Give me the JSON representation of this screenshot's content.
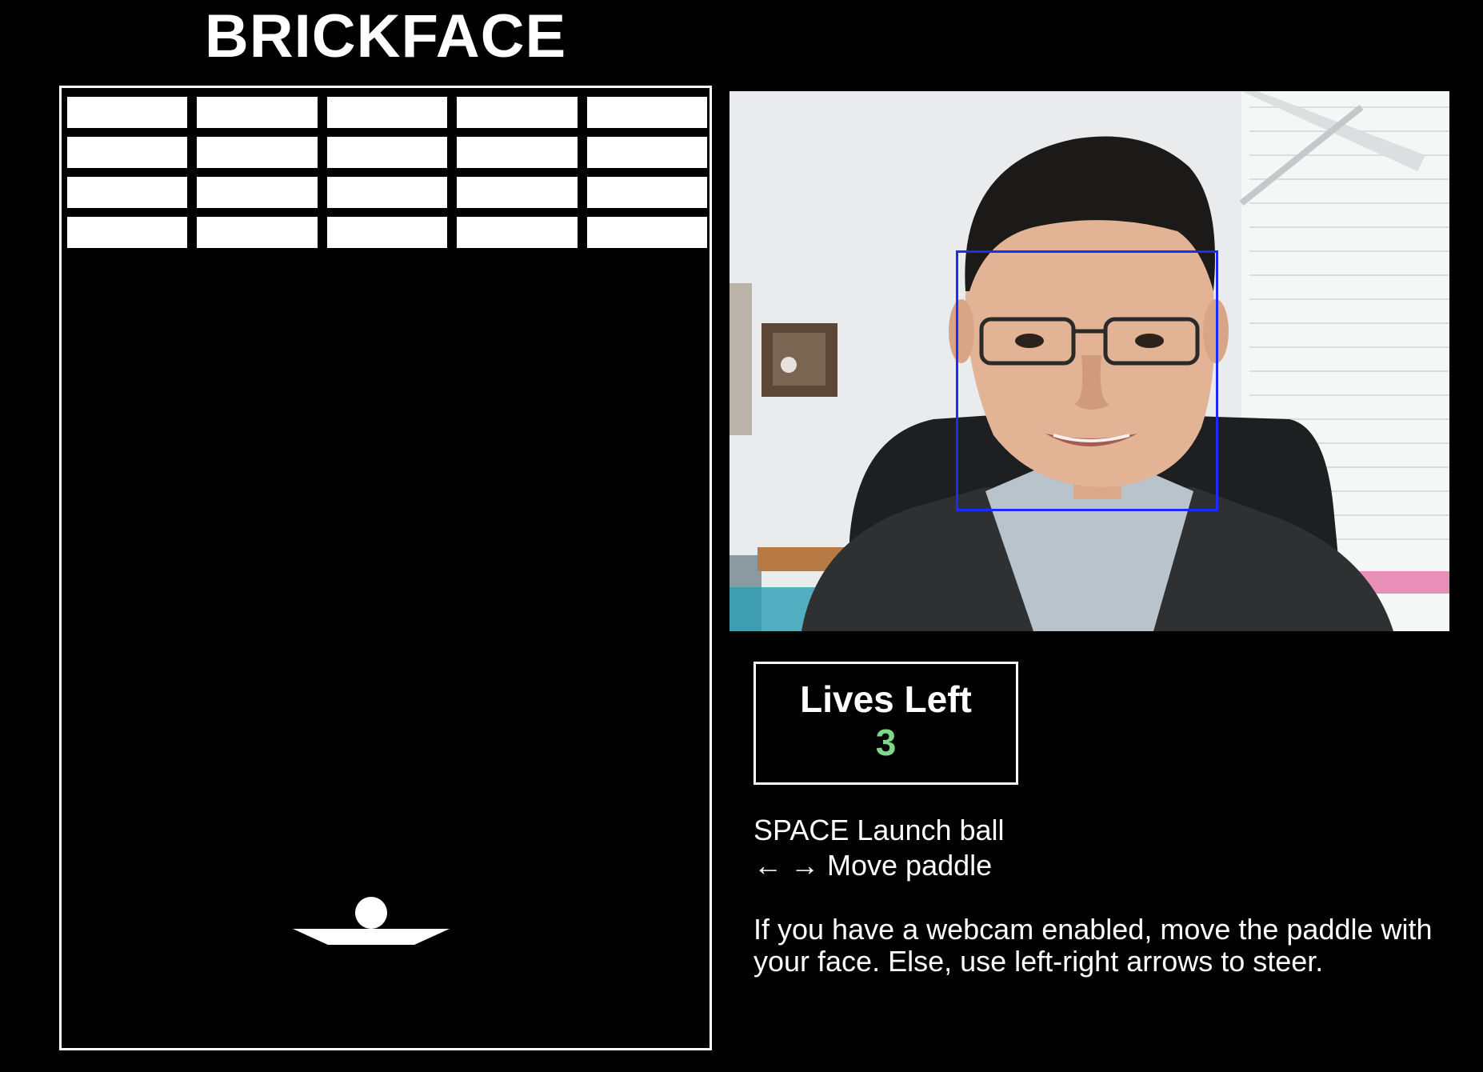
{
  "title": "BRICKFACE",
  "bricks": {
    "rows": 4,
    "columns": 5
  },
  "lives": {
    "label": "Lives Left",
    "value": "3",
    "color": "#7fd88a"
  },
  "controls": [
    {
      "key": "SPACE",
      "action": "Launch ball"
    },
    {
      "key": "← →",
      "action": "Move paddle"
    }
  ],
  "help_text": "If you have a webcam enabled, move the paddle with your face. Else, use left-right arrows to steer.",
  "webcam": {
    "face_box_color": "#1a2cff"
  }
}
